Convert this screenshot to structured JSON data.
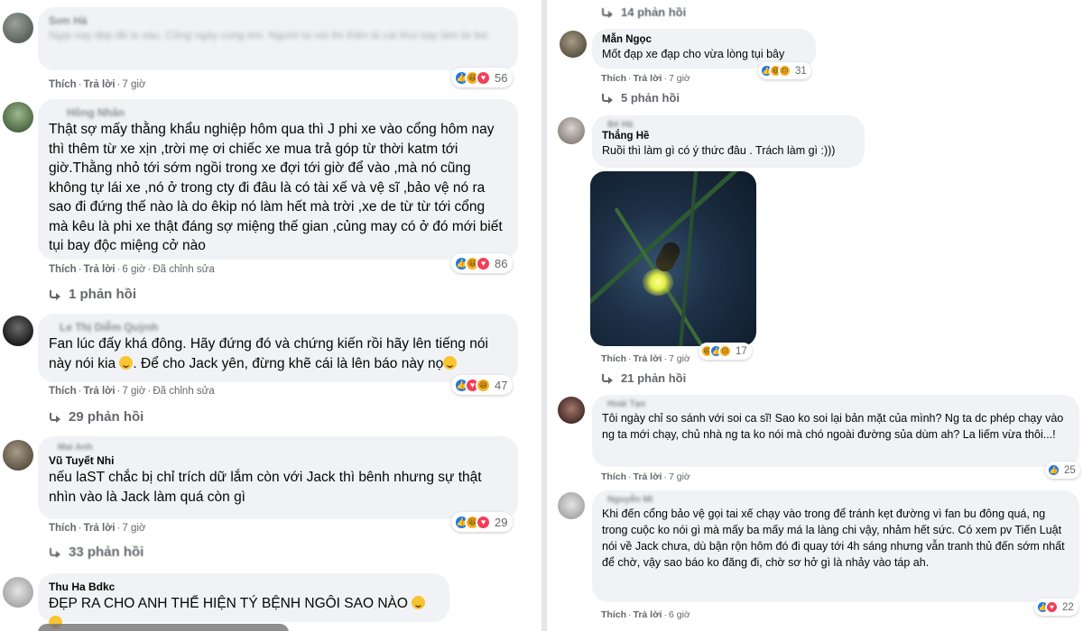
{
  "left": {
    "c1": {
      "author": "Sơn Hà",
      "text": "Ngại nay đẹp đề lo xàu. Cũng ngày cùng ém. Người ta nói thì Kiên là cái thui nay làm từ bơ.",
      "like": "Thích",
      "reply": "Trả lời",
      "time": "7 giờ",
      "reactions": [
        "like",
        "haha",
        "love"
      ],
      "count": "56"
    },
    "c2": {
      "author": "Hồng Nhân",
      "text": "Thật sợ mấy thằng khẩu nghiệp hôm qua thì J phi xe vào cổng hôm nay thì thêm từ xe xịn ,trời mẹ ơi chiếc xe mua trả góp từ thời katm tới giờ.Thằng nhỏ tới sớm ngồi trong xe đợi tới giờ để vào ,mà nó cũng không tự lái xe ,nó ở trong cty đi đâu là có tài xế và vệ sĩ ,bảo vệ nó ra sao đi đứng thế nào là do êkip nó làm hết mà trời ,xe de từ từ tới cổng mà kêu là phi xe thật đáng sợ miệng thế gian ,củng may có ở đó mới biết tụi bay độc miệng cở nào",
      "like": "Thích",
      "reply": "Trả lời",
      "time": "6 giờ",
      "edited": "Đã chỉnh sửa",
      "reactions": [
        "like",
        "haha",
        "love"
      ],
      "count": "86",
      "replies": "1 phản hồi"
    },
    "c3": {
      "author": "Le Thị Diễm Quỳnh",
      "text_a": "Fan lúc đấy khá đông. Hãy đứng đó và chứng kiến rồi hãy lên tiếng nói này nói kia ",
      "text_b": ". Để cho Jack yên, đừng khẽ cái là lên báo này nọ",
      "like": "Thích",
      "reply": "Trả lời",
      "time": "7 giờ",
      "edited": "Đã chỉnh sửa",
      "reactions": [
        "like",
        "haha",
        "love"
      ],
      "count": "47",
      "replies": "29 phản hồi"
    },
    "c4": {
      "top_name": "Mai Anh",
      "author": "Vũ Tuyết Nhi",
      "text": "nếu laST chắc bị chỉ trích dữ lắm còn với Jack thì bênh nhưng sự thật nhìn vào là Jack làm quá còn gì",
      "like": "Thích",
      "reply": "Trả lời",
      "time": "7 giờ",
      "reactions": [
        "like",
        "haha",
        "love"
      ],
      "count": "29",
      "replies": "33 phản hồi"
    },
    "c5": {
      "author": "Thu Ha Bdkc",
      "text": "ĐẸP RA CHO ANH THỂ HIỆN TÝ BỆNH NGÔI SAO NÀO"
    }
  },
  "right": {
    "top_replies": "14 phản hồi",
    "c1": {
      "author": "Mẫn Ngọc",
      "text": "Mốt đạp xe đạp cho vừa lòng tụi bây",
      "like": "Thích",
      "reply": "Trả lời",
      "time": "7 giờ",
      "reactions": [
        "like",
        "haha",
        "sad"
      ],
      "count": "31",
      "replies": "5 phản hồi"
    },
    "c2": {
      "top_name": "Bé Hà",
      "author": "Thắng Hề",
      "text": "Ruồi thì làm gì có ý thức đâu . Trách làm gì :)))",
      "like": "Thích",
      "reply": "Trả lời",
      "time": "7 giờ",
      "reactions": [
        "haha",
        "like",
        "sad"
      ],
      "count": "17",
      "replies": "21 phản hồi"
    },
    "c3": {
      "author": "Hoài Tạo",
      "text": "Tôi ngày chỉ so sánh với soi ca sĩ! Sao ko soi lại bản mặt của mình? Ng ta dc phép chạy vào ng ta mới chạy, chủ nhà ng ta ko nói mà chó ngoài đường sủa dùm ah? La liếm vừa thôi...!",
      "like": "Thích",
      "reply": "Trả lời",
      "time": "7 giờ",
      "reactions": [
        "like"
      ],
      "count": "25"
    },
    "c4": {
      "author": "Nguyễn Mi",
      "text": "Khi đến cổng bảo vệ gọi tai xế chạy vào trong để tránh kẹt đường vì fan bu đông quá, ng trong cuộc ko nói gì mà mấy ba mấy má la làng chi vậy, nhảm hết sức. Có xem pv Tiến Luật nói về Jack chưa, dù bận rộn hôm đó đi quay tới 4h sáng nhưng vẫn tranh thủ đến sớm nhất để chờ, vậy sao báo ko đăng đi, chờ sơ hở gì là nhảy vào táp ah.",
      "like": "Thích",
      "reply": "Trả lời",
      "time": "6 giờ",
      "reactions": [
        "like",
        "love"
      ],
      "count": "22"
    }
  },
  "colors": {
    "bubble": "#f0f2f5",
    "meta": "#65676b",
    "like": "#1877f2",
    "love": "#f33e58",
    "haha": "#f7b125"
  }
}
